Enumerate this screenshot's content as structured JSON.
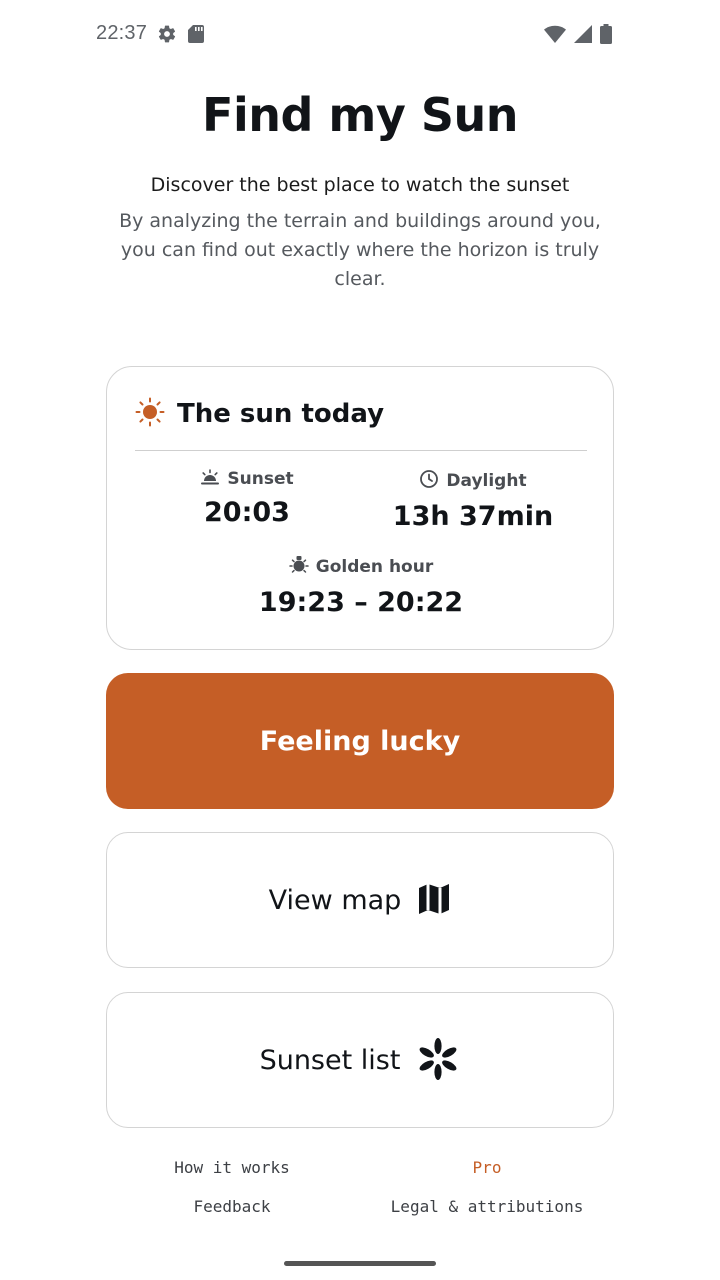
{
  "status_bar": {
    "time": "22:37",
    "icons_left": [
      "gear-icon",
      "sd-card-icon"
    ],
    "icons_right": [
      "wifi-icon",
      "signal-icon",
      "battery-icon"
    ]
  },
  "header": {
    "title": "Find my Sun",
    "subtitle": "Discover the best place to watch the sunset",
    "description": "By analyzing the terrain and buildings around you, you can find out exactly where the horizon is truly clear."
  },
  "sun_card": {
    "title": "The sun today",
    "sunset_label": "Sunset",
    "sunset_value": "20:03",
    "daylight_label": "Daylight",
    "daylight_value": "13h 37min",
    "golden_label": "Golden hour",
    "golden_value": "19:23 – 20:22"
  },
  "buttons": {
    "lucky": "Feeling lucky",
    "map": "View map",
    "list": "Sunset list"
  },
  "footer": {
    "how_it_works": "How it works",
    "pro": "Pro",
    "feedback": "Feedback",
    "legal": "Legal & attributions"
  },
  "colors": {
    "accent": "#c55e26",
    "text": "#111418",
    "muted": "#55595e",
    "border": "#d4d4d4"
  }
}
